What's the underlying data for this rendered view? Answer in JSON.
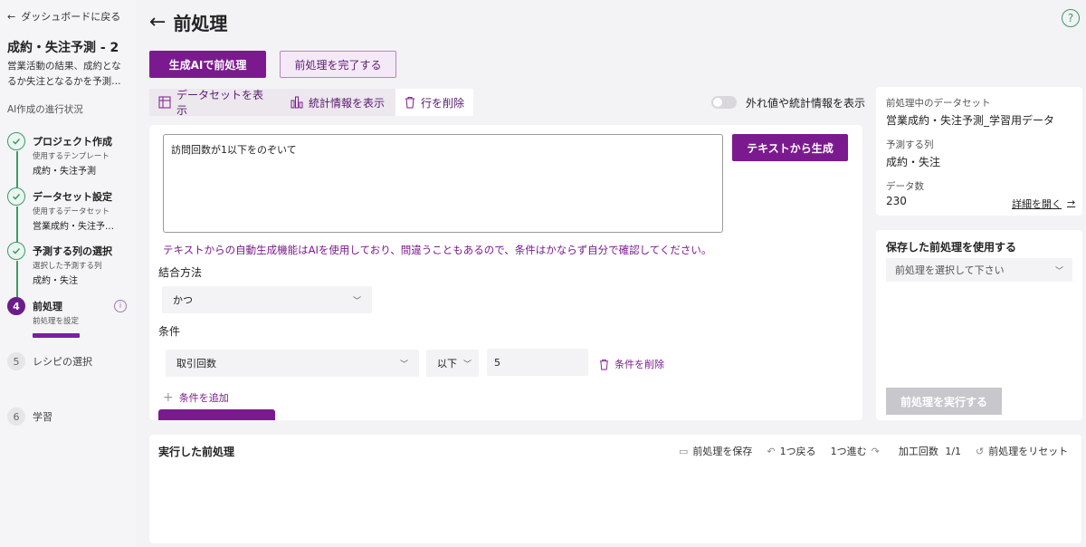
{
  "sidebar": {
    "back_label": "ダッシュボードに戻る",
    "project_title": "成約・失注予測 - 2",
    "project_desc": "営業活動の結果、成約となるか失注となるかを予測…",
    "progress_title": "AI作成の進行状況",
    "steps": [
      {
        "num": "1",
        "name": "プロジェクト作成",
        "sub": "使用するテンプレート",
        "value": "成約・失注予測",
        "state": "done"
      },
      {
        "num": "2",
        "name": "データセット設定",
        "sub": "使用するデータセット",
        "value": "営業成約・失注予…",
        "state": "done"
      },
      {
        "num": "3",
        "name": "予測する列の選択",
        "sub": "選択した予測する列",
        "value": "成約・失注",
        "state": "done"
      },
      {
        "num": "4",
        "name": "前処理",
        "sub": "前処理を設定",
        "value": "",
        "state": "active"
      },
      {
        "num": "5",
        "name": "レシピの選択",
        "sub": "",
        "value": "",
        "state": "pending"
      },
      {
        "num": "6",
        "name": "学習",
        "sub": "",
        "value": "",
        "state": "pending"
      }
    ]
  },
  "header": {
    "title": "前処理",
    "help": "?"
  },
  "actions": {
    "ai_preprocess": "生成AIで前処理",
    "complete": "前処理を完了する"
  },
  "tabs": [
    {
      "label": "データセットを表示"
    },
    {
      "label": "統計情報を表示"
    },
    {
      "label": "行を削除"
    }
  ],
  "toggle_label": "外れ値や統計情報を表示",
  "editor": {
    "text": "訪問回数が1以下をのぞいて",
    "generate_button": "テキストから生成",
    "warning": "テキストからの自動生成機能はAIを使用しており、間違うこともあるので、条件はかならず自分で確認してください。",
    "join_label": "結合方法",
    "join_value": "かつ",
    "condition_label": "条件",
    "condition_column": "取引回数",
    "condition_op": "以下",
    "condition_value": "5",
    "delete_condition": "条件を削除",
    "add_condition": "条件を追加"
  },
  "dataset_panel": {
    "dataset_label": "前処理中のデータセット",
    "dataset_value": "営業成約・失注予測_学習用データ",
    "target_label": "予測する列",
    "target_value": "成約・失注",
    "count_label": "データ数",
    "count_value": "230",
    "detail_link": "詳細を開く"
  },
  "saved_panel": {
    "title": "保存した前処理を使用する",
    "placeholder": "前処理を選択して下さい",
    "run_button": "前処理を実行する"
  },
  "history": {
    "title": "実行した前処理",
    "save": "前処理を保存",
    "undo": "1つ戻る",
    "redo": "1つ進む",
    "count_label": "加工回数",
    "count_value": "1/1",
    "reset": "前処理をリセット"
  }
}
